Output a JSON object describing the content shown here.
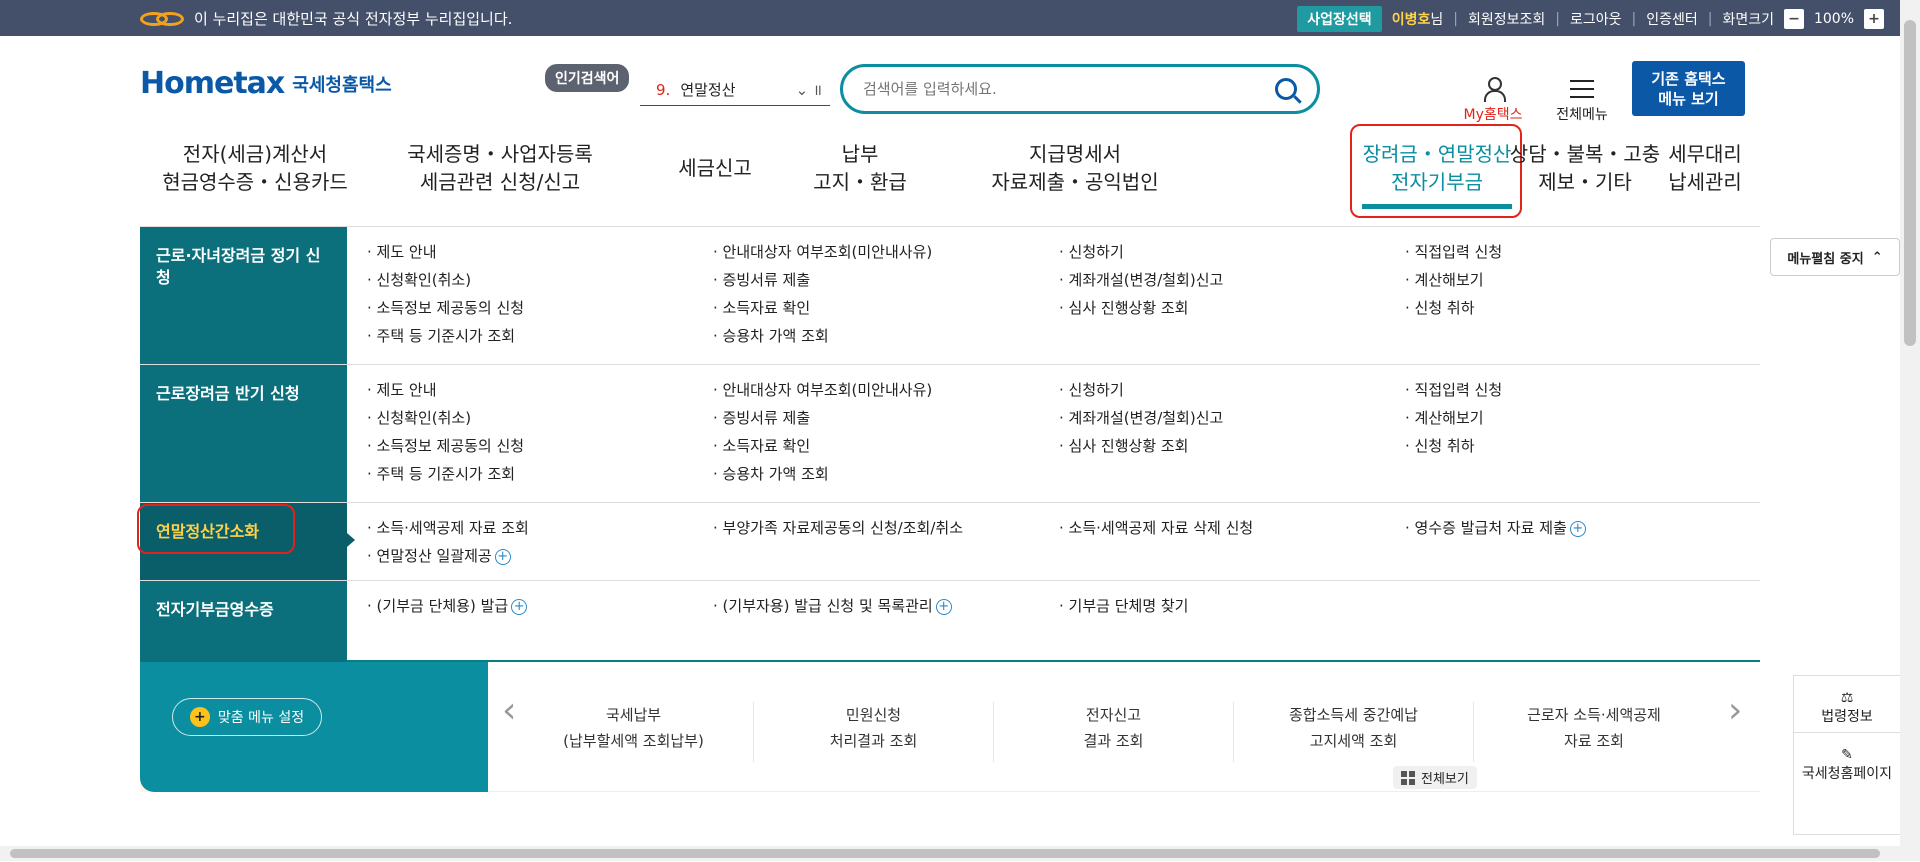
{
  "topbar": {
    "gov_notice": "이 누리집은 대한민국 공식 전자정부 누리집입니다.",
    "biz_select": "사업장선택",
    "username": "이병호",
    "username_suffix": "님",
    "links": [
      "회원정보조회",
      "로그아웃",
      "인증센터",
      "화면크기"
    ],
    "zoom": "100%"
  },
  "header": {
    "logo_text": "Hometax",
    "logo_subtitle": "국세청홈택스",
    "popular_label": "인기검색어",
    "popular_rank": "9.",
    "popular_keyword": "연말정산",
    "search_placeholder": "검색어를 입력하세요.",
    "my_hometax": "My홈택스",
    "all_menu": "전체메뉴",
    "classic_line1": "기존 홈택스",
    "classic_line2": "메뉴 보기"
  },
  "gnb": [
    {
      "l1": "전자(세금)계산서",
      "l2": "현금영수증・신용카드"
    },
    {
      "l1": "국세증명・사업자등록",
      "l2": "세금관련 신청/신고"
    },
    {
      "l1": "세금신고",
      "l2": ""
    },
    {
      "l1": "납부",
      "l2": "고지・환급"
    },
    {
      "l1": "지급명세서",
      "l2": "자료제출・공익법인"
    },
    {
      "l1": "장려금・연말정산",
      "l2": "전자기부금"
    },
    {
      "l1": "상담・불복・고충",
      "l2": "제보・기타"
    },
    {
      "l1": "세무대리",
      "l2": "납세관리"
    }
  ],
  "mega": {
    "stop_button": "메뉴펼침 중지",
    "rows": [
      {
        "category": "근로·자녀장려금 정기 신청",
        "links": [
          "제도 안내",
          "안내대상자 여부조회(미안내사유)",
          "신청하기",
          "직접입력 신청",
          "신청확인(취소)",
          "증빙서류 제출",
          "계좌개설(변경/철회)신고",
          "계산해보기",
          "소득정보 제공동의 신청",
          "소득자료 확인",
          "심사 진행상황 조회",
          "신청 취하",
          "주택 등 기준시가 조회",
          "승용차 가액 조회"
        ]
      },
      {
        "category": "근로장려금 반기 신청",
        "links": [
          "제도 안내",
          "안내대상자 여부조회(미안내사유)",
          "신청하기",
          "직접입력 신청",
          "신청확인(취소)",
          "증빙서류 제출",
          "계좌개설(변경/철회)신고",
          "계산해보기",
          "소득정보 제공동의 신청",
          "소득자료 확인",
          "심사 진행상황 조회",
          "신청 취하",
          "주택 등 기준시가 조회",
          "승용차 가액 조회"
        ]
      },
      {
        "category": "연말정산간소화",
        "links": [
          "소득·세액공제 자료 조회",
          "부양가족 자료제공동의 신청/조회/취소",
          "소득·세액공제 자료 삭제 신청",
          "영수증 발급처 자료 제출",
          "연말정산 일괄제공"
        ]
      },
      {
        "category": "전자기부금영수증",
        "links": [
          "(기부금 단체용) 발급",
          "(기부자용) 발급 신청 및 목록관리",
          "기부금 단체명 찾기"
        ]
      }
    ]
  },
  "quick": {
    "set_button": "맞춤 메뉴 설정",
    "view_all": "전체보기",
    "items": [
      {
        "l1": "국세납부",
        "l2": "(납부할세액 조회납부)"
      },
      {
        "l1": "민원신청",
        "l2": "처리결과 조회"
      },
      {
        "l1": "전자신고",
        "l2": "결과 조회"
      },
      {
        "l1": "종합소득세 중간예납",
        "l2": "고지세액 조회"
      },
      {
        "l1": "근로자 소득·세액공제",
        "l2": "자료 조회"
      }
    ]
  },
  "side": {
    "law": "법령정보",
    "page": "국세청홈페이지"
  }
}
